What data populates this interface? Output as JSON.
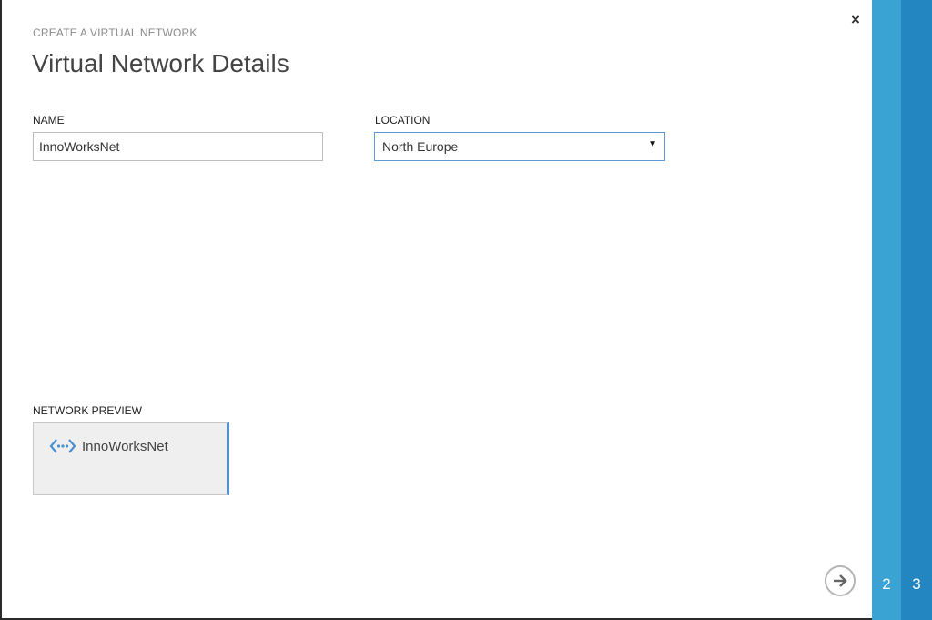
{
  "wizard": {
    "subtitle": "CREATE A VIRTUAL NETWORK",
    "title": "Virtual Network Details",
    "close_symbol": "×",
    "steps": [
      "2",
      "3"
    ]
  },
  "form": {
    "name_label": "NAME",
    "name_value": "InnoWorksNet",
    "location_label": "LOCATION",
    "location_value": "North Europe",
    "location_caret": "▼"
  },
  "preview": {
    "label": "NETWORK PREVIEW",
    "network_name": "InnoWorksNet",
    "icon": "virtual-network-icon"
  },
  "colors": {
    "accent": "#3aa3d4",
    "accent_dark": "#2386c0",
    "select_border": "#5a9bd5",
    "icon": "#4a8fd0"
  }
}
